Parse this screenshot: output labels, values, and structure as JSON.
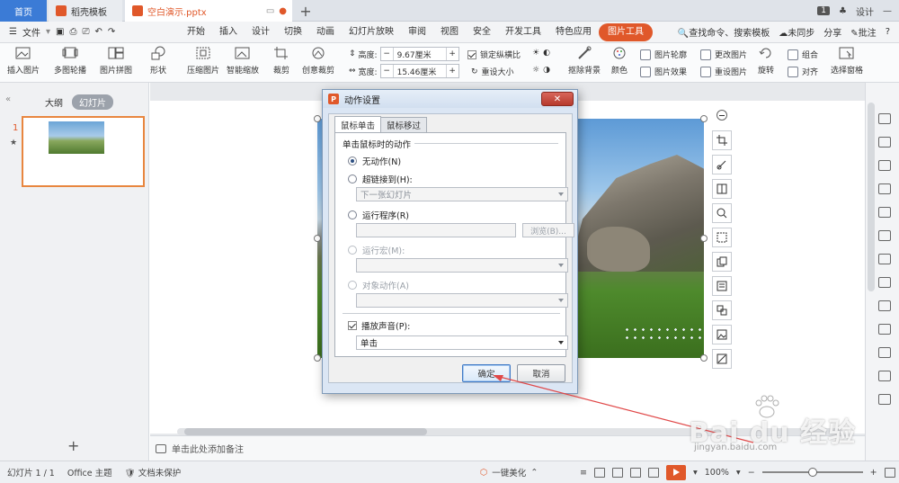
{
  "tabbar": {
    "home": "首页",
    "template_tab": "稻壳模板",
    "doc_tab": "空白演示.pptx",
    "window_badge": "1",
    "design": "设计"
  },
  "menubar": {
    "file": "文件",
    "tabs": [
      "开始",
      "插入",
      "设计",
      "切换",
      "动画",
      "幻灯片放映",
      "审阅",
      "视图",
      "安全",
      "开发工具",
      "特色应用",
      "图片工具"
    ],
    "active_tab": "图片工具",
    "search": "查找命令、搜索模板",
    "unsynced": "未同步",
    "share": "分享",
    "annotate": "批注",
    "help": "?"
  },
  "ribbon": {
    "insert_picture": "插入图片",
    "multi_rotate": "多图轮播",
    "picture_mosaic": "图片拼图",
    "shape": "形状",
    "compress": "压缩图片",
    "smart_zoom": "智能缩放",
    "crop": "裁剪",
    "creative_crop": "创意裁剪",
    "height_label": "高度:",
    "height_value": "9.67厘米",
    "width_label": "宽度:",
    "width_value": "15.46厘米",
    "lock_ratio": "锁定纵横比",
    "reset_size": "重设大小",
    "remove_bg": "抠除背景",
    "color": "颜色",
    "outline": "图片轮廓",
    "effect": "图片效果",
    "change_pic": "更改图片",
    "reset_pic": "重设图片",
    "rotate": "旋转",
    "group": "组合",
    "align": "对齐",
    "select_pane": "选择窗格"
  },
  "left_panel": {
    "outline_tab": "大纲",
    "slides_tab": "幻灯片",
    "slide_number": "1",
    "star": "★",
    "add": "+"
  },
  "notes": {
    "placeholder": "单击此处添加备注"
  },
  "status": {
    "slide_info": "幻灯片 1 / 1",
    "theme": "Office 主题",
    "protection": "文档未保护",
    "beautify": "一键美化",
    "zoom": "100%",
    "zoom_minus": "−",
    "zoom_plus": "+",
    "zoom_level": 0.5
  },
  "dialog": {
    "title": "动作设置",
    "close": "✕",
    "tabs": [
      "鼠标单击",
      "鼠标移过"
    ],
    "group_label": "单击鼠标时的动作",
    "options": {
      "none": "无动作(N)",
      "hyperlink": "超链接到(H):",
      "hyperlink_value": "下一张幻灯片",
      "run_program": "运行程序(R)",
      "browse": "浏览(B)...",
      "run_macro": "运行宏(M):",
      "object_action": "对象动作(A)"
    },
    "play_sound": "播放声音(P):",
    "sound_value": "单击",
    "ok": "确定",
    "cancel": "取消"
  },
  "watermark": {
    "text": "Bai du 经验",
    "url": "jingyan.baidu.com"
  },
  "colors": {
    "accent": "#e0582a",
    "home_tab": "#3b7bd6"
  }
}
